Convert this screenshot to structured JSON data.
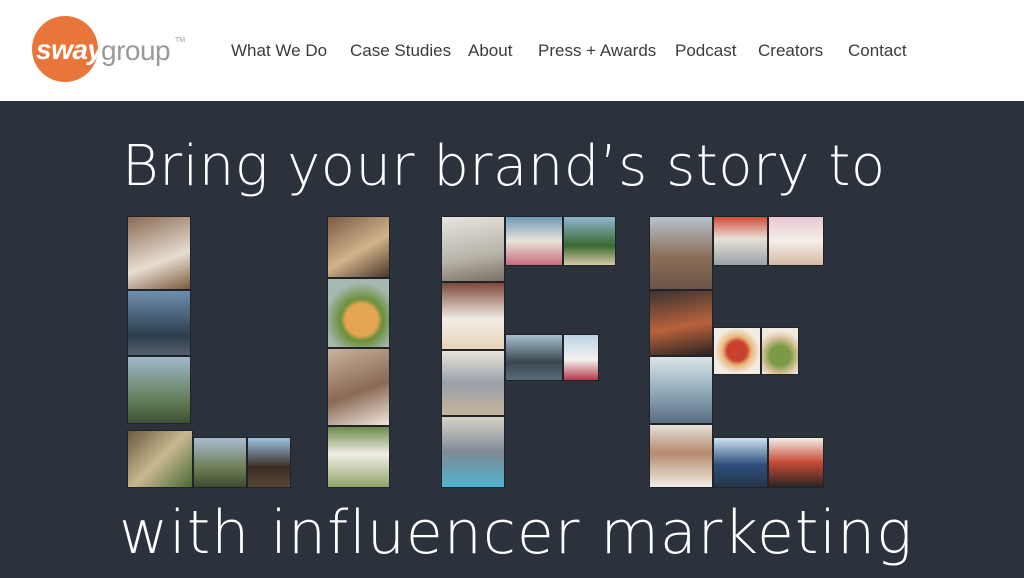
{
  "brand": {
    "logo_word_main": "sway",
    "logo_word_secondary": "group",
    "logo_mark": "TM",
    "accent_color": "#e8763a",
    "background": "#2b323c"
  },
  "nav": {
    "items": [
      "What We Do",
      "Case Studies",
      "About",
      "Press + Awards",
      "Podcast",
      "Creators",
      "Contact"
    ]
  },
  "hero": {
    "headline_top": "Bring your brand’s story to",
    "word_collage": "LIFE",
    "headline_bottom": "with influencer marketing"
  }
}
